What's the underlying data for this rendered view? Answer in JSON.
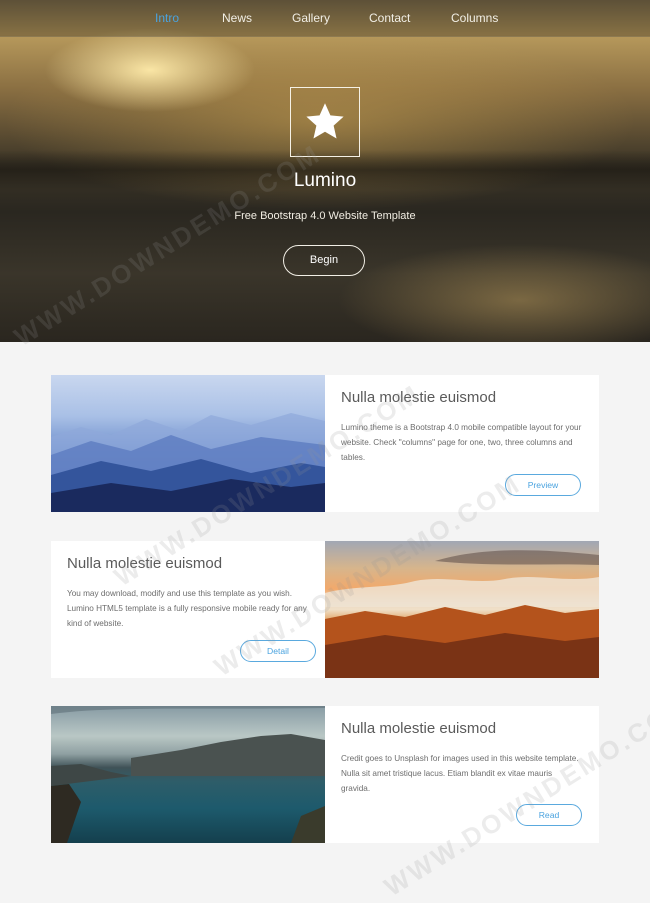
{
  "nav": {
    "items": [
      {
        "label": "Intro",
        "active": true
      },
      {
        "label": "News",
        "active": false
      },
      {
        "label": "Gallery",
        "active": false
      },
      {
        "label": "Contact",
        "active": false
      },
      {
        "label": "Columns",
        "active": false
      }
    ]
  },
  "hero": {
    "logo_icon": "star-icon",
    "title": "Lumino",
    "subtitle": "Free Bootstrap 4.0 Website Template",
    "button_label": "Begin"
  },
  "cards": [
    {
      "title": "Nulla molestie euismod",
      "body": "Lumino theme is a Bootstrap 4.0 mobile compatible layout for your website. Check \"columns\" page for one, two, three columns and tables.",
      "button_label": "Preview",
      "image": "misty-blue-mountains"
    },
    {
      "title": "Nulla molestie euismod",
      "body": "You may download, modify and use this template as you wish. Lumino HTML5 template is a fully responsive mobile ready for any kind of website.",
      "button_label": "Detail",
      "image": "sunset-over-clouds-and-peaks"
    },
    {
      "title": "Nulla molestie euismod",
      "body": "Credit goes to Unsplash for images used in this website template. Nulla sit amet tristique lacus. Etiam blandit ex vitae mauris gravida.",
      "button_label": "Read",
      "image": "lake-with-hills"
    }
  ],
  "watermark": "WWW.DOWNDEMO.COM",
  "colors": {
    "accent": "#4aa3df",
    "page_background": "#f4f4f4",
    "card_background": "#ffffff"
  }
}
